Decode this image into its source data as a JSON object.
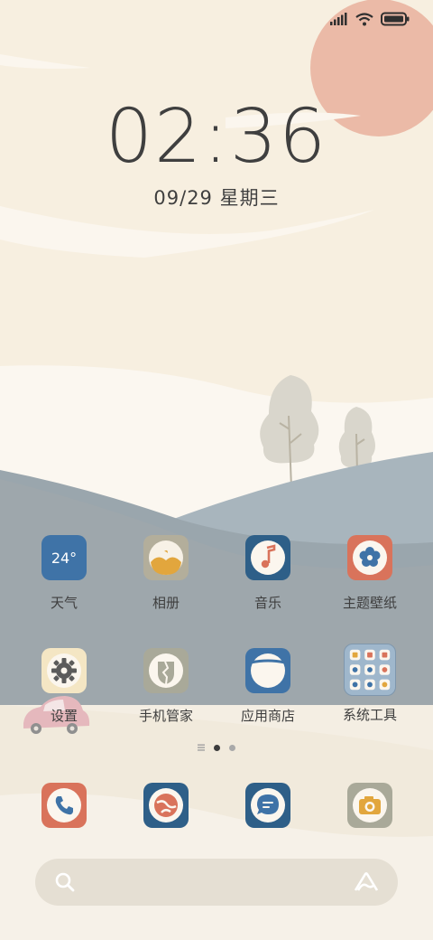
{
  "lockscreen": {
    "time": "02:36",
    "date": "09/29 星期三"
  },
  "apps": [
    {
      "label": "天气",
      "icon": "weather-icon",
      "badge_text": "24°",
      "color": "#3f73a7"
    },
    {
      "label": "相册",
      "icon": "gallery-icon",
      "color": "#b3ae9b"
    },
    {
      "label": "音乐",
      "icon": "music-icon",
      "color": "#2e5f88"
    },
    {
      "label": "主题壁纸",
      "icon": "themes-icon",
      "color": "#d9735b"
    },
    {
      "label": "设置",
      "icon": "settings-icon",
      "color": "#f4e6c4"
    },
    {
      "label": "手机管家",
      "icon": "security-icon",
      "color": "#a9a999"
    },
    {
      "label": "应用商店",
      "icon": "app-store-icon",
      "color": "#3f73a7"
    },
    {
      "label": "系统工具",
      "icon": "folder-icon",
      "color": "#9fb7cc"
    }
  ],
  "dock": [
    {
      "name": "phone",
      "icon": "phone-icon",
      "color": "#d9735b"
    },
    {
      "name": "browser",
      "icon": "browser-icon",
      "color": "#2e5f88"
    },
    {
      "name": "messages",
      "icon": "messages-icon",
      "color": "#2e5f88"
    },
    {
      "name": "camera",
      "icon": "camera-icon",
      "color": "#a9a999"
    }
  ],
  "pager": {
    "pages": 2,
    "current": 1
  },
  "search": {
    "icon": "search-icon",
    "assistant_icon": "assistant-icon"
  },
  "status": {
    "signal": "signal-icon",
    "wifi": "wifi-icon",
    "battery": "battery-icon"
  }
}
